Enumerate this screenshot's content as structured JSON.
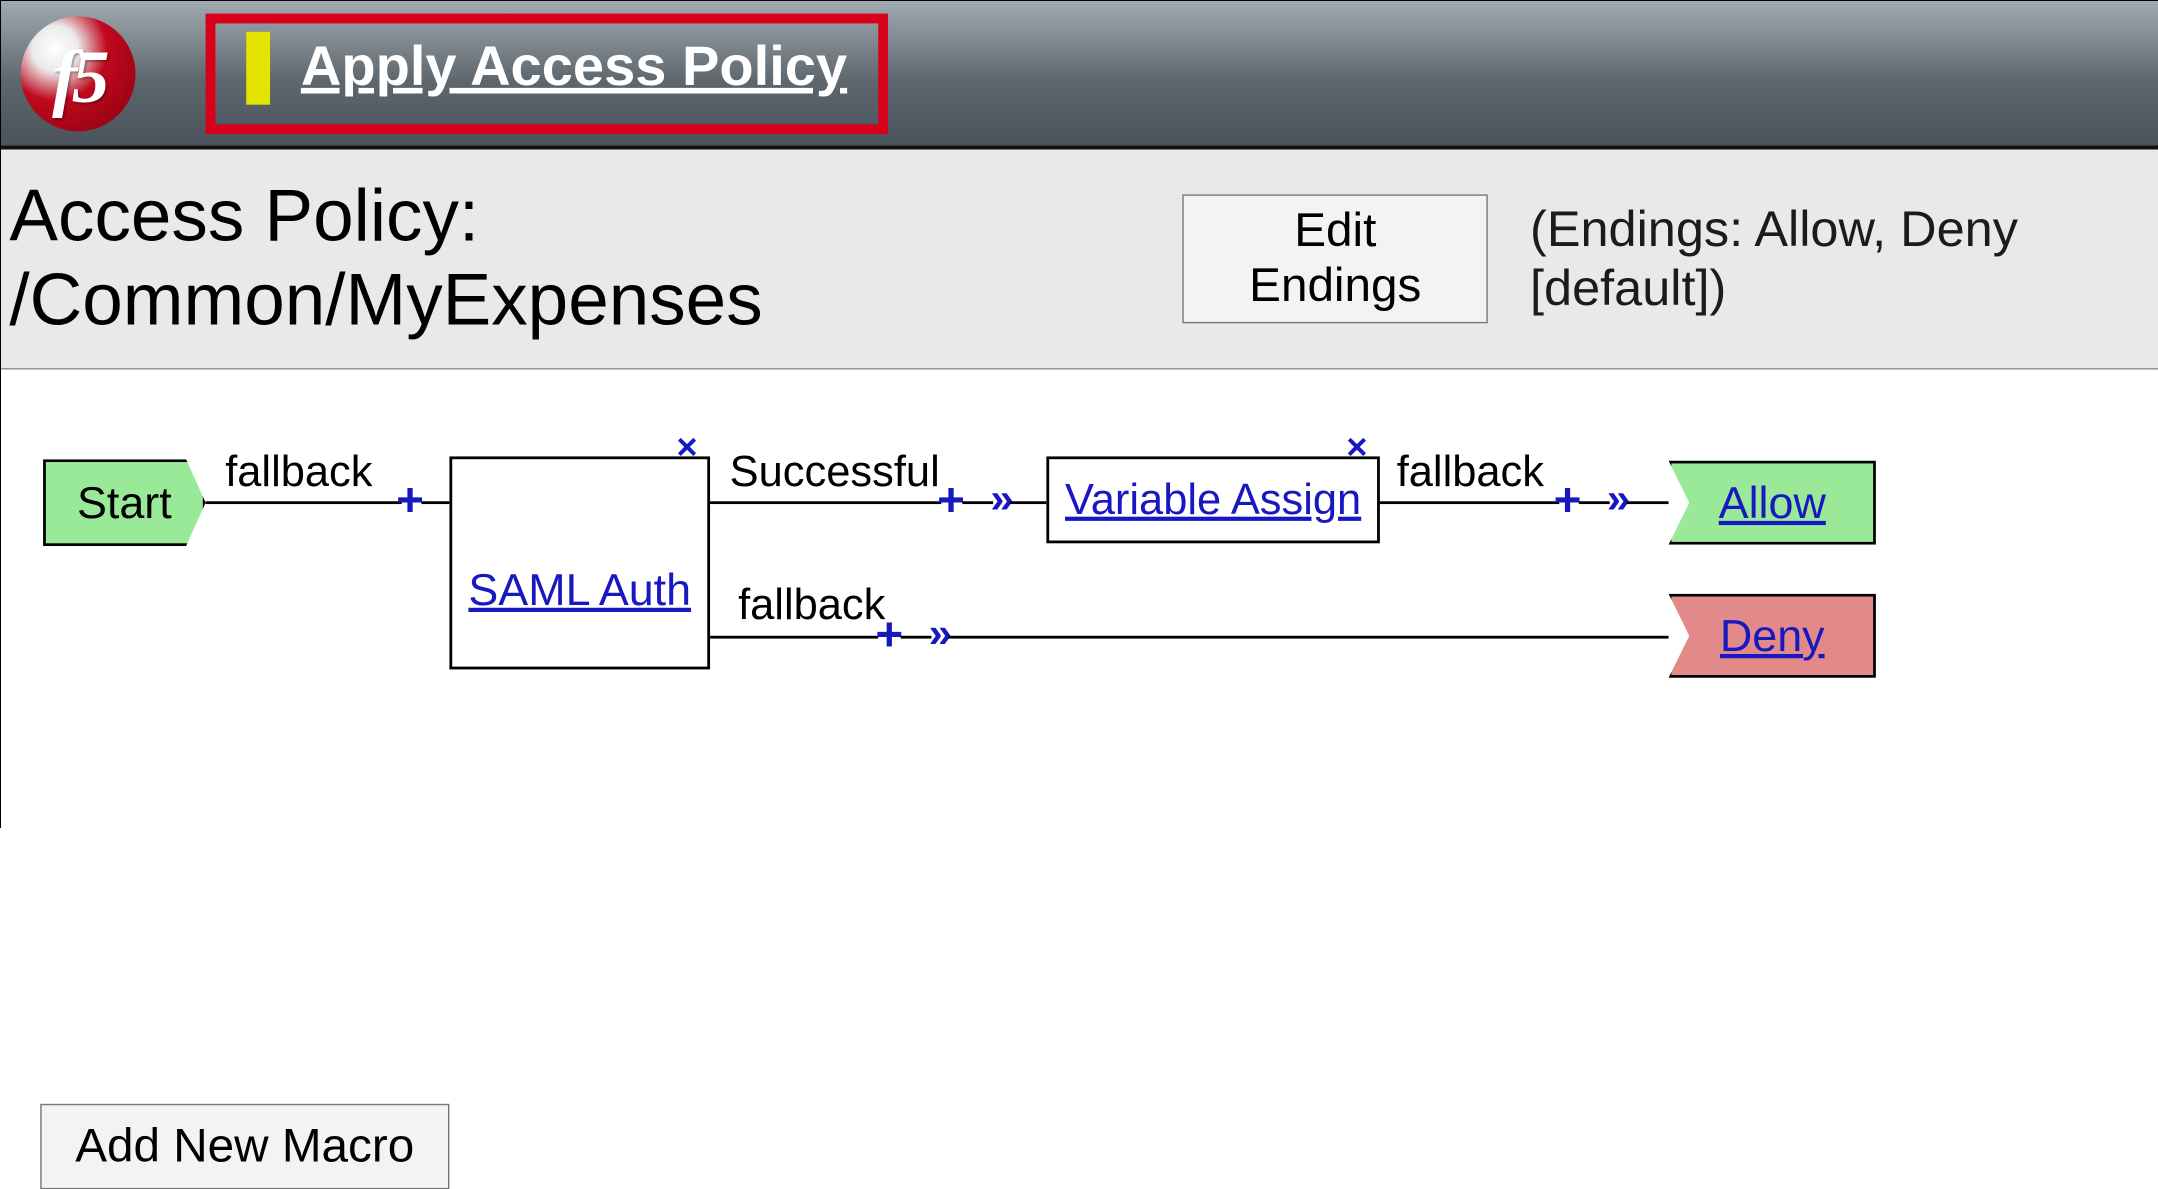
{
  "logo": {
    "text": "f5"
  },
  "header": {
    "apply_label": "Apply Access Policy"
  },
  "title": {
    "text": "Access Policy: /Common/MyExpenses",
    "edit_endings_label": "Edit Endings",
    "endings_info": "(Endings: Allow, Deny [default])"
  },
  "flow": {
    "start_label": "Start",
    "saml": {
      "label": "SAML Auth",
      "out_success_label": "Successful",
      "out_fallback_label": "fallback"
    },
    "edge_start_fallback": "fallback",
    "var_assign": {
      "label": "Variable Assign",
      "out_fallback_label": "fallback"
    },
    "endings": {
      "allow": "Allow",
      "deny": "Deny"
    },
    "node_x": "×",
    "plus": "+",
    "chev": "»"
  },
  "footer": {
    "add_macro_label": "Add New Macro"
  }
}
